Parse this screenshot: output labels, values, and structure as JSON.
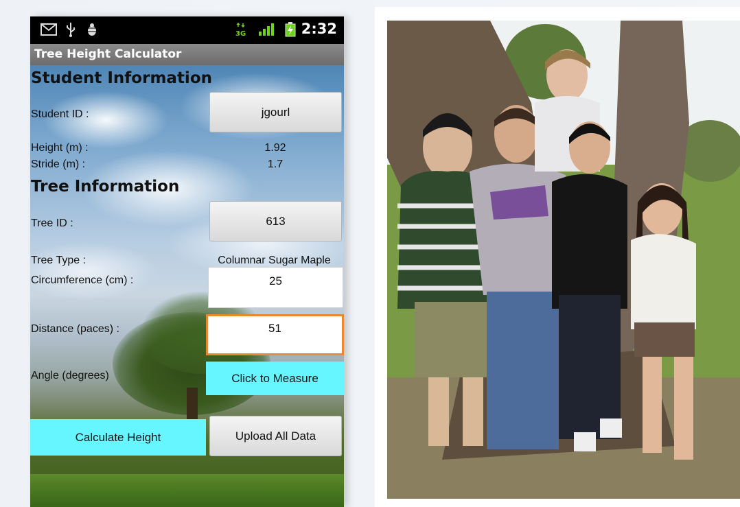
{
  "status_bar": {
    "time": "2:32",
    "network_label": "3G",
    "icons": [
      "mail-icon",
      "usb-icon",
      "debug-icon",
      "network-3g-icon",
      "signal-icon",
      "battery-charging-icon"
    ]
  },
  "app": {
    "title": "Tree Height Calculator"
  },
  "student_section": {
    "heading": "Student Information",
    "student_id_label": "Student ID :",
    "student_id_value": "jgourl",
    "height_label": "Height (m)  :",
    "height_value": "1.92",
    "stride_label": "Stride (m) :",
    "stride_value": "1.7"
  },
  "tree_section": {
    "heading": "Tree Information",
    "tree_id_label": "Tree ID :",
    "tree_id_value": "613",
    "tree_type_label": "Tree Type :",
    "tree_type_value": "Columnar Sugar Maple",
    "circumference_label": "Circumference (cm) :",
    "circumference_value": "25",
    "distance_label": "Distance (paces) :",
    "distance_value": "51",
    "angle_label": "Angle (degrees)",
    "measure_button": "Click to Measure"
  },
  "actions": {
    "calculate_button": "Calculate Height",
    "upload_button": "Upload All Data"
  },
  "colors": {
    "accent_cyan": "#66f6ff",
    "focus_orange": "#e8892f",
    "title_bar": "#7a7a7a"
  }
}
